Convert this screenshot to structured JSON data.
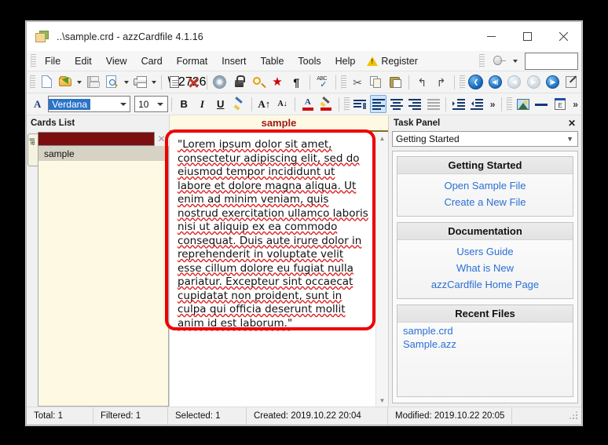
{
  "window": {
    "title": "..\\sample.crd - azzCardfile 4.1.16",
    "icon": "cardfile-icon",
    "controls": {
      "minimize": "–",
      "maximize": "☐",
      "close": "✕"
    }
  },
  "menu": {
    "items": [
      {
        "label": "File",
        "name": "menu-file"
      },
      {
        "label": "Edit",
        "name": "menu-edit"
      },
      {
        "label": "View",
        "name": "menu-view"
      },
      {
        "label": "Card",
        "name": "menu-card"
      },
      {
        "label": "Format",
        "name": "menu-format"
      },
      {
        "label": "Insert",
        "name": "menu-insert"
      },
      {
        "label": "Table",
        "name": "menu-table"
      },
      {
        "label": "Tools",
        "name": "menu-tools"
      },
      {
        "label": "Help",
        "name": "menu-help"
      }
    ],
    "register": "Register",
    "search_value": ""
  },
  "toolbar_main": {
    "buttons": [
      "new-file-icon",
      "open-file-icon",
      "save-icon",
      "print-preview-icon",
      "print-icon",
      "new-card-icon",
      "delete-card-icon",
      "options-icon",
      "lock-icon",
      "find-icon",
      "favorite-icon",
      "paragraph-marks-icon",
      "spellcheck-icon",
      "cut-icon",
      "copy-icon",
      "paste-icon",
      "undo-icon",
      "redo-icon",
      "back-icon",
      "first-card-icon",
      "previous-card-icon",
      "next-card-icon",
      "last-card-icon",
      "edit-card-icon"
    ]
  },
  "toolbar_format": {
    "font_name": "Verdana",
    "font_size": "10",
    "bold": "B",
    "italic": "I",
    "underline": "U",
    "overflow": "»",
    "active_alignment": "align-left"
  },
  "cards_list": {
    "header": "Cards List",
    "tab_label": "all",
    "filter_value": "",
    "clear_label": "✕",
    "items": [
      {
        "label": "sample",
        "selected": true
      }
    ]
  },
  "card": {
    "title": "sample",
    "text": "\"Lorem ipsum dolor sit amet, consectetur adipiscing elit, sed do eiusmod tempor incididunt ut labore et dolore magna aliqua. Ut enim ad minim veniam, quis nostrud exercitation ullamco laboris nisi ut aliquip ex ea commodo consequat. Duis aute irure dolor in reprehenderit in voluptate velit esse cillum dolore eu fugiat nulla pariatur. Excepteur sint occaecat cupidatat non proident, sunt in culpa qui officia deserunt mollit anim id est laborum.\""
  },
  "task_panel": {
    "header": "Task Panel",
    "close_label": "✕",
    "selected_view": "Getting Started",
    "sections": [
      {
        "title": "Getting Started",
        "align": "center",
        "links": [
          "Open Sample File",
          "Create a New File"
        ]
      },
      {
        "title": "Documentation",
        "align": "center",
        "links": [
          "Users Guide",
          "What is New",
          "azzCardfile Home Page"
        ]
      },
      {
        "title": "Recent Files",
        "align": "left",
        "links": [
          "sample.crd",
          "Sample.azz"
        ]
      }
    ]
  },
  "status_bar": {
    "total": "Total: 1",
    "filtered": "Filtered: 1",
    "selected": "Selected: 1",
    "created": "Created: 2019.10.22 20:04",
    "modified": "Modified: 2019.10.22 20:05"
  },
  "colors": {
    "accent_red": "#ee0000",
    "card_title": "#9e1a1a",
    "filter_box": "#7b0f10",
    "link": "#2a6fd6",
    "list_bg": "#fdf9e3"
  }
}
